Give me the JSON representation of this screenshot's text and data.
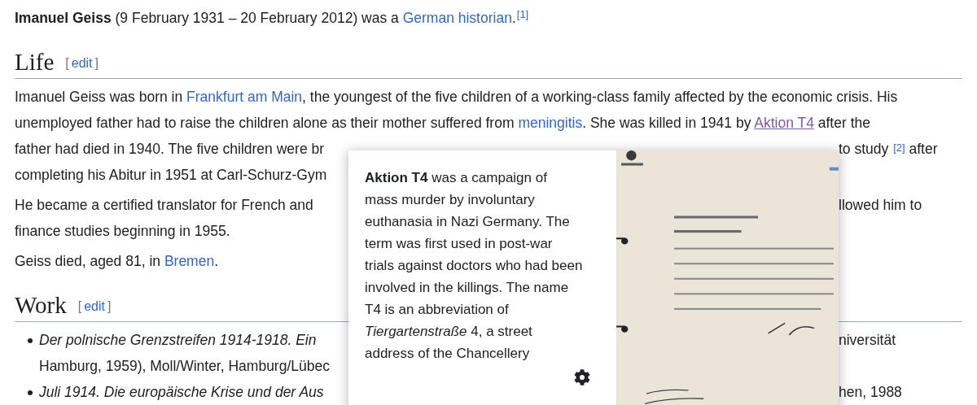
{
  "intro": [
    {
      "kind": "text",
      "text": "**Imanuel Geiss** (9 February 1931 – 20 February 2012) was a "
    },
    {
      "kind": "link",
      "text": "German historian"
    },
    {
      "kind": "text",
      "text": ".$^{[1]}$"
    }
  ],
  "sections": [
    {
      "heading": "Life",
      "edit": {
        "open": "[",
        "label": "edit",
        "close": "]"
      },
      "paragraphs": [
        {
          "lines": [
            {
              "left": [
                {
                  "kind": "text",
                  "text": "Imanuel Geiss was born in "
                },
                {
                  "kind": "link",
                  "text": "Frankfurt am Main"
                },
                {
                  "kind": "text",
                  "text": ", the youngest of the five children of a working-class family affected by the economic crisis. His"
                }
              ]
            },
            {
              "left": [
                {
                  "kind": "text",
                  "text": "unemployed father had to raise the children alone as their mother suffered from "
                },
                {
                  "kind": "link",
                  "text": "meningitis"
                },
                {
                  "kind": "text",
                  "text": ". She was killed in 1941 by "
                },
                {
                  "kind": "hovered-link",
                  "text": "Aktion T4"
                },
                {
                  "kind": "text",
                  "text": " after the"
                }
              ]
            },
            {
              "left": [
                {
                  "kind": "text",
                  "text": "father had died in 1940. The five children were br"
                }
              ],
              "right": [
                {
                  "kind": "text",
                  "text": "to study "
                },
                {
                  "kind": "ref",
                  "text": "[2]"
                },
                {
                  "kind": "text",
                  "text": " after"
                }
              ]
            },
            {
              "left": [
                {
                  "kind": "text",
                  "text": "completing his Abitur in 1951 at Carl-Schurz-Gym"
                }
              ]
            }
          ]
        },
        {
          "lines": [
            {
              "left": [
                {
                  "kind": "text",
                  "text": "He became a certified translator for French and"
                }
              ],
              "right": [
                {
                  "kind": "text",
                  "text": "llowed him to"
                }
              ]
            },
            {
              "left": [
                {
                  "kind": "text",
                  "text": "finance studies beginning in 1955."
                }
              ]
            }
          ]
        },
        {
          "lines": [
            {
              "left": [
                {
                  "kind": "text",
                  "text": "Geiss died, aged 81, in "
                },
                {
                  "kind": "link",
                  "text": "Bremen"
                },
                {
                  "kind": "text",
                  "text": "."
                }
              ]
            }
          ]
        }
      ]
    },
    {
      "heading": "Work",
      "edit": {
        "open": "[",
        "label": "edit",
        "close": "]"
      },
      "list": [
        {
          "lines": [
            {
              "left": [
                {
                  "kind": "title",
                  "text": "Der polnische Grenzstreifen 1914-1918. Ein"
                }
              ],
              "right": [
                {
                  "kind": "text",
                  "text": "niversität"
                }
              ]
            },
            {
              "left": [
                {
                  "kind": "text",
                  "text": "Hamburg, 1959), Moll/Winter, Hamburg/Lübec"
                }
              ]
            }
          ]
        },
        {
          "lines": [
            {
              "left": [
                {
                  "kind": "title",
                  "text": "Juli 1914. Die europäische Krise und der Aus"
                }
              ],
              "right": [
                {
                  "kind": "text",
                  "text": "hen, 1988"
                }
              ]
            }
          ]
        }
      ]
    }
  ],
  "popup": {
    "extract": "**Aktion T4** was a campaign of mass murder by involuntary euthanasia in Nazi Germany. The term was first used in post-war trials against doctors who had been involved in the killings. The name T4 is an abbreviation of *Tiergartenstraße* 4, a street address of the Chancellery"
  }
}
